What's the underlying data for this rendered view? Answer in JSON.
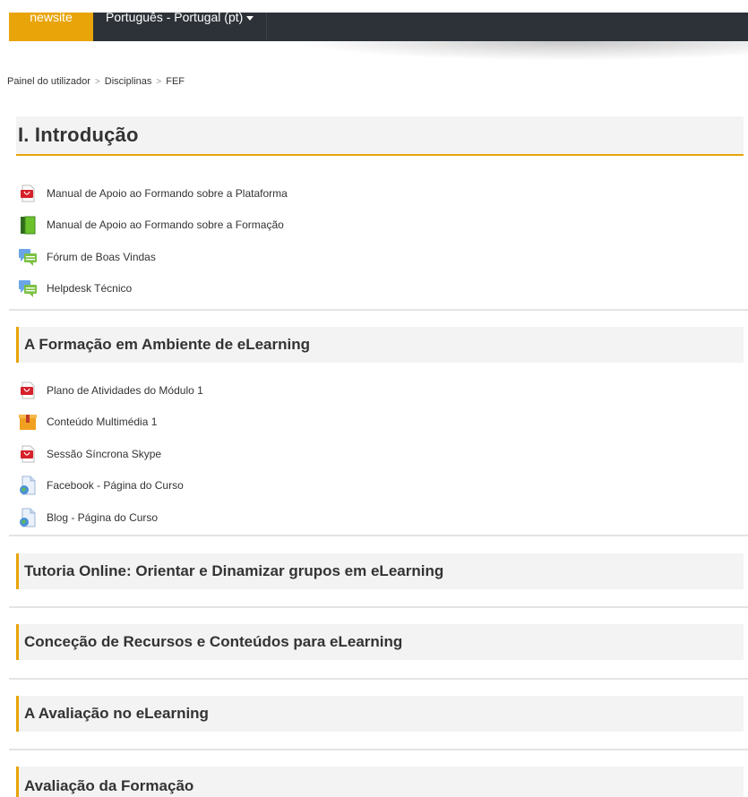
{
  "nav": {
    "brand": "newsite",
    "language": "Português - Portugal (pt)"
  },
  "breadcrumb": [
    "Painel do utilizador",
    "Disciplinas",
    "FEF"
  ],
  "sections": [
    {
      "title": "I. Introdução",
      "activities": [
        {
          "label": "Manual de Apoio ao Formando sobre a Plataforma",
          "icon": "pdf-icon"
        },
        {
          "label": "Manual de Apoio ao Formando sobre a Formação",
          "icon": "book-icon"
        },
        {
          "label": "Fórum de Boas Vindas",
          "icon": "forum-icon"
        },
        {
          "label": "Helpdesk Técnico",
          "icon": "forum-icon"
        }
      ]
    },
    {
      "title": "A Formação em Ambiente de eLearning",
      "activities": [
        {
          "label": "Plano de Atividades do Módulo 1",
          "icon": "pdf-icon"
        },
        {
          "label": "Conteúdo Multimédia 1",
          "icon": "package-icon"
        },
        {
          "label": "Sessão Síncrona Skype",
          "icon": "pdf-icon"
        },
        {
          "label": "Facebook - Página do Curso",
          "icon": "url-icon"
        },
        {
          "label": "Blog - Página do Curso",
          "icon": "url-icon"
        }
      ]
    },
    {
      "title": "Tutoria Online: Orientar e Dinamizar grupos em eLearning",
      "activities": []
    },
    {
      "title": "Conceção de Recursos e Conteúdos para eLearning",
      "activities": []
    },
    {
      "title": "A Avaliação no eLearning",
      "activities": []
    },
    {
      "title": "Avaliação da Formação",
      "activities": []
    }
  ],
  "colors": {
    "accent": "#e8a409",
    "navbar": "#2d3238",
    "section_bg": "#f3f3f3"
  }
}
